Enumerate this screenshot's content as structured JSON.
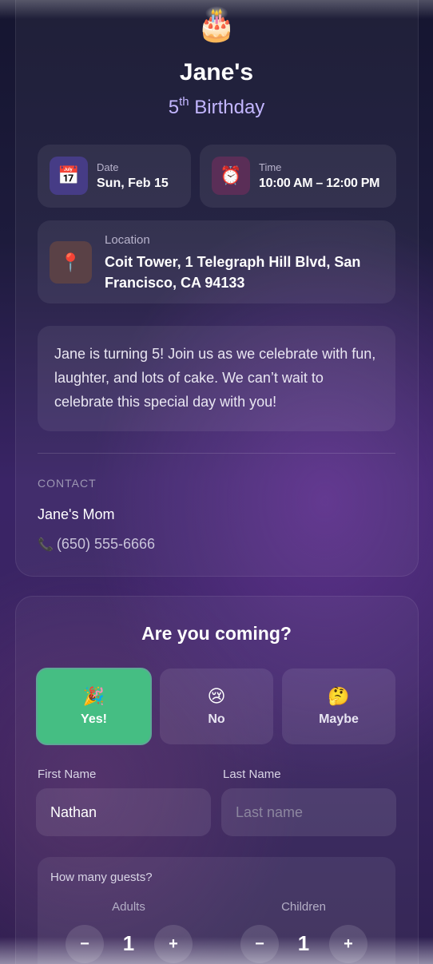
{
  "event": {
    "cake_icon": "🎂",
    "title": "Jane's",
    "ordinal_number": "5",
    "ordinal_suffix": "th",
    "subtitle_text": "Birthday",
    "date": {
      "icon": "📅",
      "label": "Date",
      "value": "Sun, Feb 15"
    },
    "time": {
      "icon": "⏰",
      "label": "Time",
      "value": "10:00 AM – 12:00 PM"
    },
    "location": {
      "icon": "📍",
      "label": "Location",
      "line1": "Coit Tower, 1 Telegraph Hill Blvd, San",
      "line2": "Francisco, CA 94133"
    },
    "message": "Jane is turning 5! Join us as we celebrate with fun, laughter, and lots of cake. We can’t wait to celebrate this special day with you!",
    "contact": {
      "heading": "CONTACT",
      "name": "Jane's Mom",
      "phone_icon": "📞",
      "phone": "(650) 555-6666"
    }
  },
  "rsvp": {
    "title": "Are you coming?",
    "options": [
      {
        "emoji": "🎉",
        "label": "Yes!",
        "selected": true
      },
      {
        "emoji": "😢",
        "label": "No",
        "selected": false
      },
      {
        "emoji": "🤔",
        "label": "Maybe",
        "selected": false
      }
    ],
    "first_name": {
      "label": "First Name",
      "value": "Nathan",
      "placeholder": "First name"
    },
    "last_name": {
      "label": "Last Name",
      "value": "",
      "placeholder": "Last name"
    },
    "guests": {
      "heading": "How many guests?",
      "adults": {
        "label": "Adults",
        "value": "1"
      },
      "children": {
        "label": "Children",
        "value": "1"
      },
      "minus": "−",
      "plus": "+"
    }
  },
  "colors": {
    "accent_selected": "#45be83",
    "subtitle": "#c3b6ff"
  }
}
